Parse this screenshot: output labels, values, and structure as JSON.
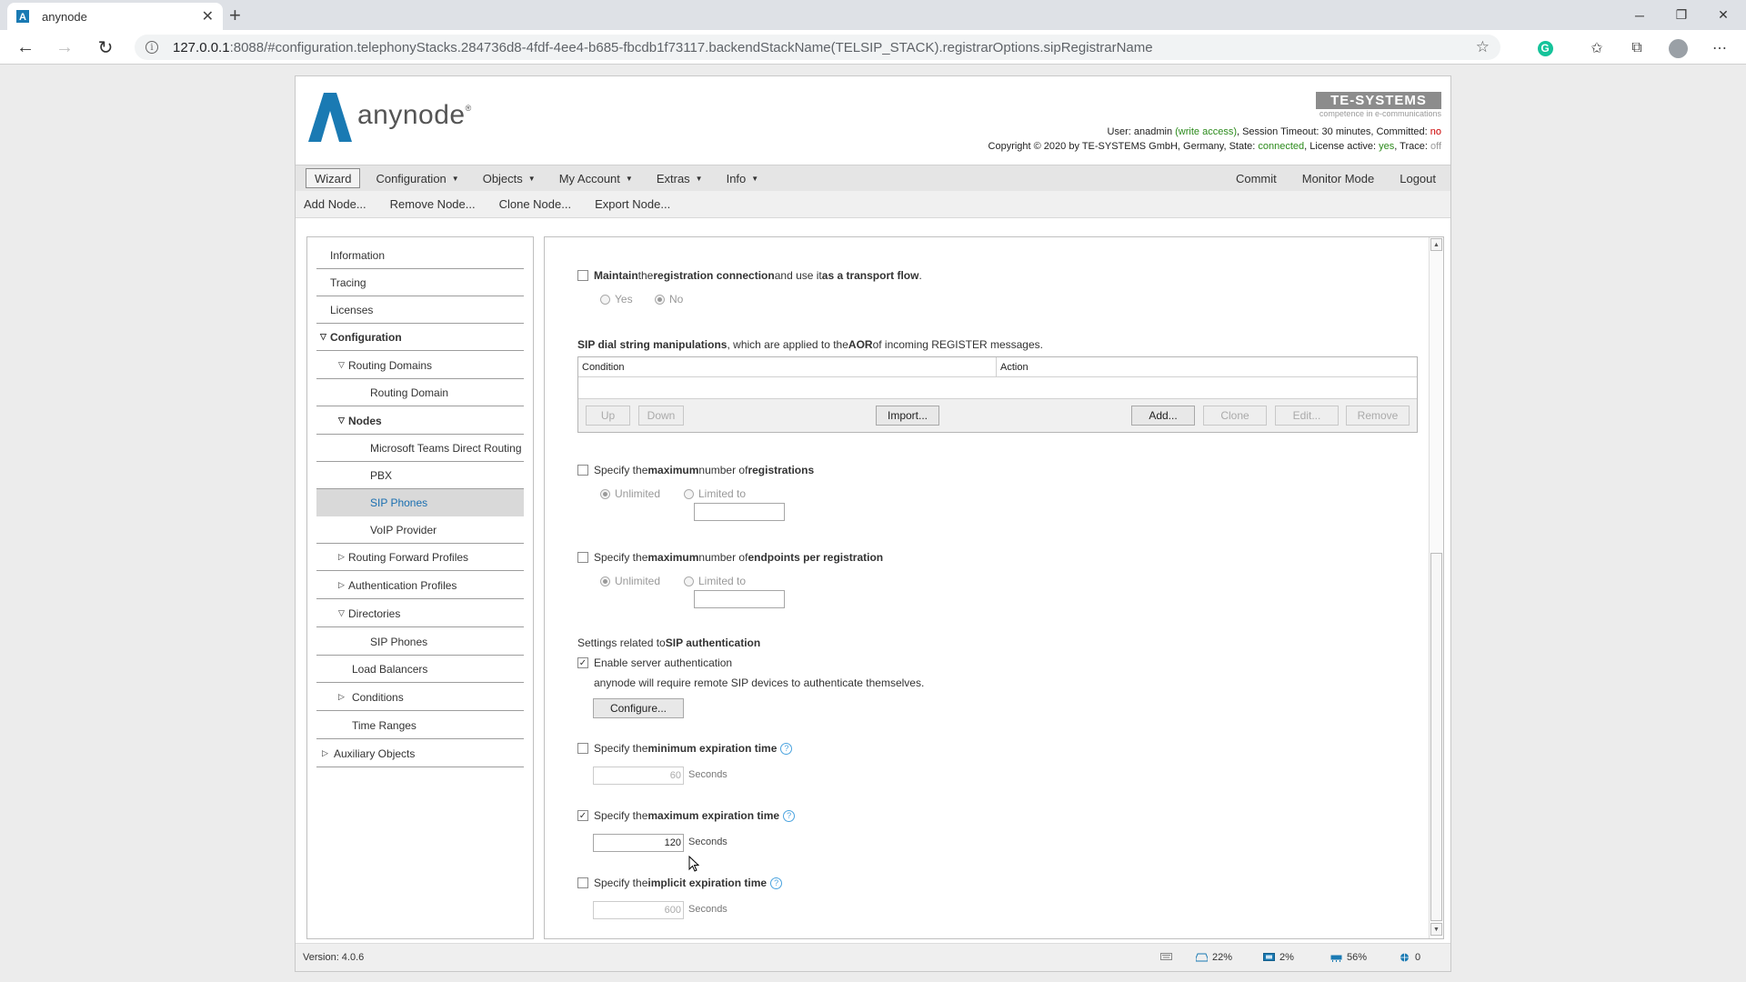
{
  "browser": {
    "tab_title": "anynode",
    "tab_close": "✕",
    "new_tab": "+",
    "url_host": "127.0.0.1",
    "url_rest": ":8088/#configuration.telephonyStacks.284736d8-4fdf-4ee4-b685-fbcdb1f73117.backendStackName(TELSIP_STACK).registrarOptions.sipRegistrarName",
    "window_controls": {
      "minimize": "─",
      "restore": "❐",
      "close": "✕"
    }
  },
  "header": {
    "product": "anynode",
    "vendor": "TE-SYSTEMS",
    "vendor_tagline": "competence in e-communications",
    "user_prefix": "User: ",
    "user": "anadmin",
    "user_access": "(write access)",
    "session_timeout": ", Session Timeout: 30 minutes, Committed: ",
    "committed": "no",
    "copyright": "Copyright © 2020 by TE-SYSTEMS GmbH, Germany, State: ",
    "state": "connected",
    "license_label": ", License active: ",
    "license": "yes",
    "trace_label": ", Trace: ",
    "trace": "off"
  },
  "menu": {
    "items": [
      "Wizard",
      "Configuration",
      "Objects",
      "My Account",
      "Extras",
      "Info"
    ],
    "right": [
      "Commit",
      "Monitor Mode",
      "Logout"
    ]
  },
  "toolbar": [
    "Add Node...",
    "Remove Node...",
    "Clone Node...",
    "Export Node..."
  ],
  "sidebar": {
    "items": [
      "Information",
      "Tracing",
      "Licenses",
      "Configuration",
      "Routing Domains",
      "Routing Domain",
      "Nodes",
      "Microsoft Teams Direct Routing",
      "PBX",
      "SIP Phones",
      "VoIP Provider",
      "Routing Forward Profiles",
      "Authentication Profiles",
      "Directories",
      "SIP Phones",
      "Load Balancers",
      "Conditions",
      "Time Ranges",
      "Auxiliary Objects"
    ]
  },
  "content": {
    "maintain": {
      "p1": "Maintain",
      "p2": " the ",
      "p3": "registration connection",
      "p4": " and use it ",
      "p5": "as a transport flow",
      "p6": "."
    },
    "yes": "Yes",
    "no": "No",
    "dial": {
      "p1": "SIP dial string manipulations",
      "p2": ", which are applied to the ",
      "p3": "AOR",
      "p4": " of incoming REGISTER messages."
    },
    "table": {
      "col_condition": "Condition",
      "col_action": "Action",
      "up": "Up",
      "down": "Down",
      "import": "Import...",
      "add": "Add...",
      "clone": "Clone",
      "edit": "Edit...",
      "remove": "Remove"
    },
    "max_reg": {
      "p1": "Specify the ",
      "p2": "maximum",
      "p3": " number of ",
      "p4": "registrations"
    },
    "unlimited": "Unlimited",
    "limited_to": "Limited to",
    "max_ep": {
      "p1": "Specify the ",
      "p2": "maximum",
      "p3": " number of ",
      "p4": "endpoints per registration"
    },
    "auth_heading": {
      "p1": "Settings related to ",
      "p2": "SIP authentication"
    },
    "enable_auth": "Enable server authentication",
    "auth_desc": "anynode will require remote SIP devices to authenticate themselves.",
    "configure": "Configure...",
    "min_exp": {
      "p1": "Specify the ",
      "p2": "minimum expiration time",
      "value": "60"
    },
    "max_exp": {
      "p1": "Specify the ",
      "p2": "maximum expiration time",
      "value": "120"
    },
    "impl_exp": {
      "p1": "Specify the ",
      "p2": "implicit expiration time",
      "value": "600"
    },
    "seconds": "Seconds",
    "help": "?"
  },
  "status": {
    "version": "Version: 4.0.6",
    "disk": "22%",
    "cpu": "2%",
    "memory": "56%",
    "count": "0"
  }
}
